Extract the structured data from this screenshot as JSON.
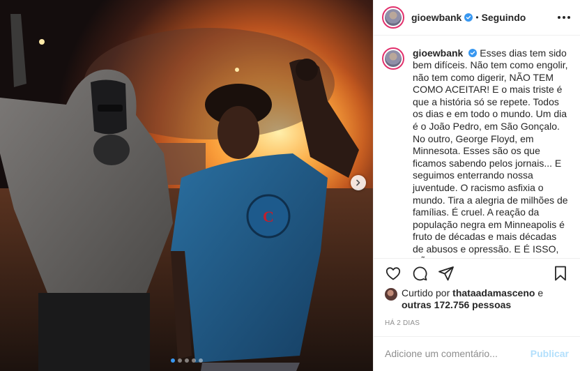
{
  "header": {
    "username": "gioewbank",
    "separator": "•",
    "follow_status": "Seguindo",
    "verified_icon": "verified-badge-icon",
    "more_icon": "more-options-icon"
  },
  "caption": {
    "username": "gioewbank",
    "text": "Esses dias tem sido bem difíceis. Não tem como engolir, não tem como digerir, NÃO TEM COMO ACEITAR! E o mais triste é que a história só se repete. Todos os dias e em todo o mundo. Um dia é o João Pedro, em São Gonçalo. No outro, George Floyd, em Minnesota. Esses são os que ficamos sabendo pelos jornais... E seguimos enterrando nossa juventude. O racismo asfixia o mundo. Tira a alegria de milhões de famílias. É cruel. A reação da população negra em Minneapolis é fruto de décadas e mais décadas de abusos e opressão. E É ISSO, NÃO PODEMOS MAIS ACEITAR! Que toda essa dor sirva para criar uma nova consciência. Façamos NÓS! LUTEMOS NÓS! RACISTAS NÃO"
  },
  "actions": {
    "like_icon": "heart-icon",
    "comment_icon": "comment-icon",
    "share_icon": "share-icon",
    "save_icon": "bookmark-icon"
  },
  "likes": {
    "prefix": "Curtido por ",
    "liker": "thataadamasceno",
    "middle": " e ",
    "others": "outras 172.756 pessoas"
  },
  "date": "HÁ 2 DIAS",
  "comment": {
    "placeholder": "Adicione um comentário...",
    "post_label": "Publicar"
  },
  "carousel": {
    "total": 5,
    "active_index": 1,
    "next_icon": "chevron-right-icon"
  },
  "colors": {
    "accent_blue": "#3897f0",
    "verified_blue": "#3897f0",
    "post_disabled": "#b2dffc",
    "text": "#262626",
    "muted": "#8e8e8e"
  }
}
